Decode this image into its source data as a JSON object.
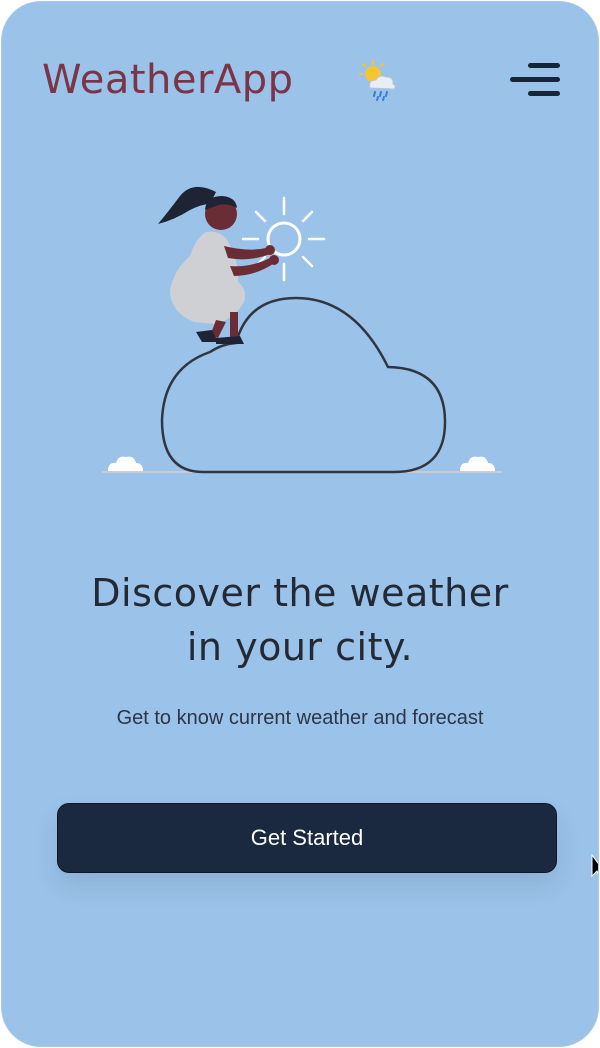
{
  "app": {
    "name": "WeatherApp",
    "logo_icon": "sun-cloud-rain-icon",
    "menu_icon": "hamburger-menu-icon"
  },
  "hero": {
    "illustration": "woman-on-cloud-with-sun-illustration",
    "headline_line1": "Discover the weather",
    "headline_line2": "in your city.",
    "subtitle": "Get to know current weather and forecast"
  },
  "cta": {
    "label": "Get Started"
  },
  "colors": {
    "background": "#9bc2e9",
    "brand": "#7a3648",
    "text_dark": "#232a35",
    "button_bg": "#1b2940",
    "button_text": "#ffffff"
  }
}
